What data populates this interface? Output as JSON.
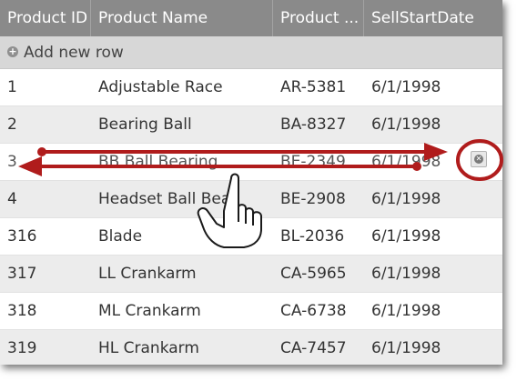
{
  "columns": [
    "Product ID",
    "Product Name",
    "Product ...",
    "SellStartDate"
  ],
  "add_row_label": "Add new row",
  "rows": [
    {
      "id": "1",
      "name": "Adjustable Race",
      "number": "AR-5381",
      "date": "6/1/1998"
    },
    {
      "id": "2",
      "name": "Bearing Ball",
      "number": "BA-8327",
      "date": "6/1/1998"
    },
    {
      "id": "3",
      "name": "BB Ball Bearing",
      "number": "BE-2349",
      "date": "6/1/1998"
    },
    {
      "id": "4",
      "name": "Headset Ball Bea",
      "number": "BE-2908",
      "date": "6/1/1998"
    },
    {
      "id": "316",
      "name": "Blade",
      "number": "BL-2036",
      "date": "6/1/1998"
    },
    {
      "id": "317",
      "name": "LL Crankarm",
      "number": "CA-5965",
      "date": "6/1/1998"
    },
    {
      "id": "318",
      "name": "ML Crankarm",
      "number": "CA-6738",
      "date": "6/1/1998"
    },
    {
      "id": "319",
      "name": "HL Crankarm",
      "number": "CA-7457",
      "date": "6/1/1998"
    }
  ],
  "icons": {
    "add": "plus-circle-icon",
    "delete": "close-circle-icon",
    "gesture": "hand-pointer-icon",
    "swipe": "double-arrow-icon"
  },
  "colors": {
    "header_bg": "#8a8a8a",
    "add_row_bg": "#d7d7d7",
    "alt_row_bg": "#ececec",
    "annotation": "#b01c1c"
  }
}
